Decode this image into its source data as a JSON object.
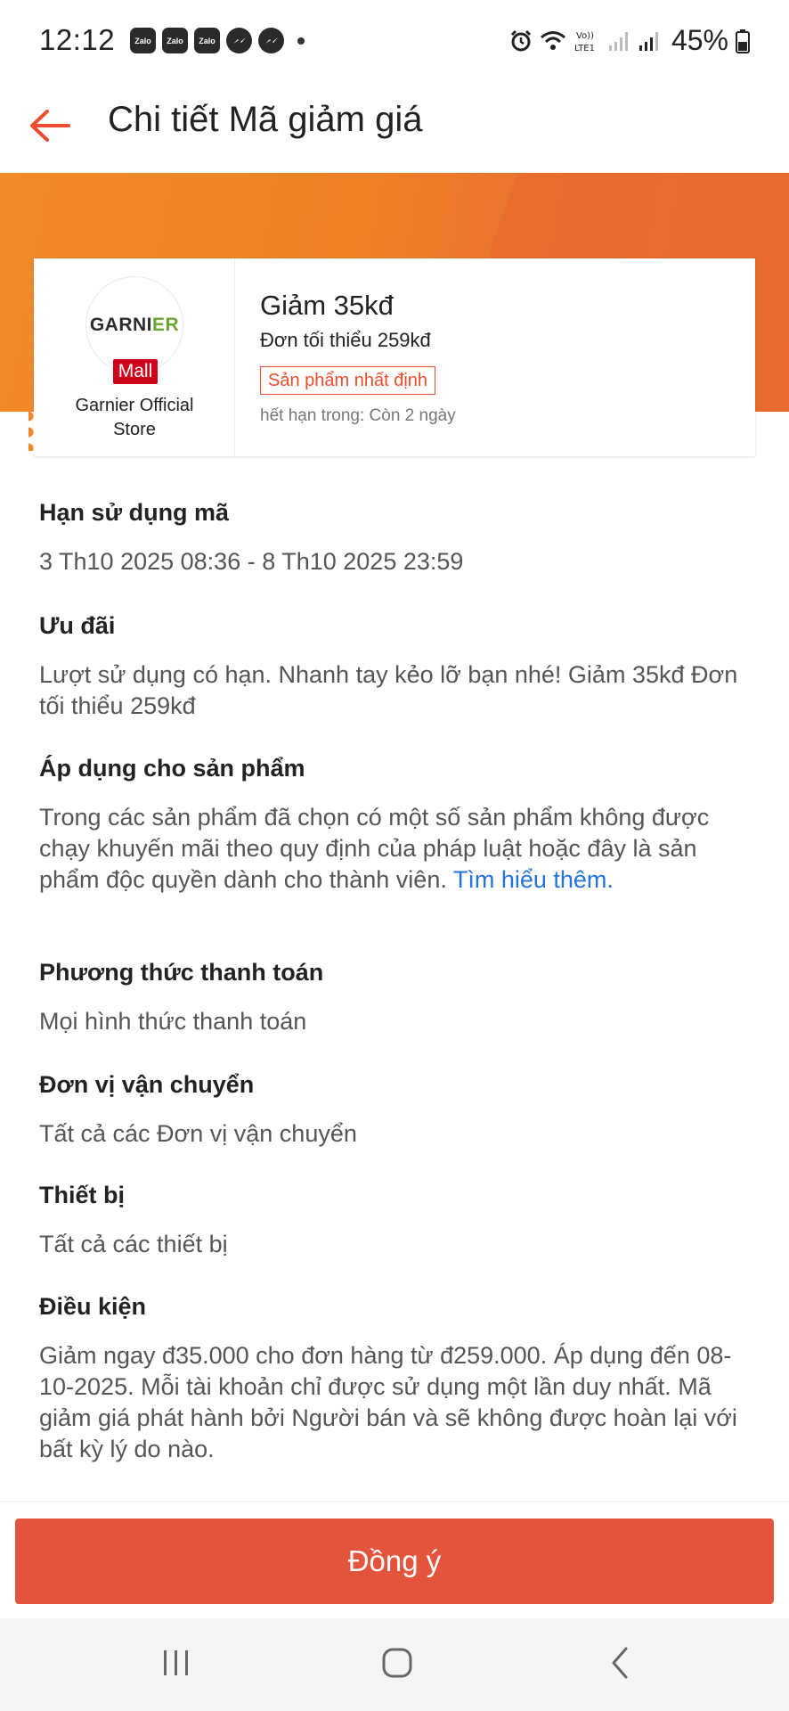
{
  "status_bar": {
    "time": "12:12",
    "app_icons": [
      "Zalo",
      "Zalo",
      "Zalo"
    ],
    "battery": "45%"
  },
  "header": {
    "title": "Chi tiết Mã giảm giá"
  },
  "voucher": {
    "store_logo_text_a": "GARNI",
    "store_logo_text_b": "ER",
    "mall_badge": "Mall",
    "store_name": "Garnier Official Store",
    "title": "Giảm 35kđ",
    "min_order": "Đơn tối thiểu 259kđ",
    "tag": "Sản phẩm nhất định",
    "expiry": "hết hạn trong: Còn 2 ngày"
  },
  "sections": {
    "validity": {
      "title": "Hạn sử dụng mã",
      "body": "3 Th10 2025 08:36 - 8 Th10 2025 23:59"
    },
    "offer": {
      "title": "Ưu đãi",
      "body": "Lượt sử dụng có hạn. Nhanh tay kẻo lỡ bạn nhé! Giảm 35kđ Đơn tối thiểu 259kđ"
    },
    "products": {
      "title": "Áp dụng cho sản phẩm",
      "body": "Trong các sản phẩm đã chọn có một số sản phẩm không được chạy khuyến mãi theo quy định của pháp luật hoặc đây là sản phẩm độc quyền dành cho thành viên.",
      "link": "Tìm hiểu thêm."
    },
    "payment": {
      "title": "Phương thức thanh toán",
      "body": "Mọi hình thức thanh toán"
    },
    "shipping": {
      "title": "Đơn vị vận chuyển",
      "body": "Tất cả các Đơn vị vận chuyển"
    },
    "device": {
      "title": "Thiết bị",
      "body": "Tất cả các thiết bị"
    },
    "conditions": {
      "title": "Điều kiện",
      "body": "Giảm ngay đ35.000 cho đơn hàng từ đ259.000. Áp dụng đến 08-10-2025. Mỗi tài khoản chỉ được sử dụng một lần duy nhất. Mã giảm giá phát hành bởi Người bán và sẽ không được hoàn lại với bất kỳ lý do nào."
    }
  },
  "footer": {
    "agree_label": "Đồng ý"
  },
  "colors": {
    "brand_orange": "#ee4d2d",
    "button": "#e2543b",
    "link": "#2673dd",
    "band": "#f08a2b"
  },
  "icons": {
    "back": "arrow-left-icon",
    "nav_recents": "recents-icon",
    "nav_home": "home-icon",
    "nav_back": "chevron-left-icon"
  }
}
